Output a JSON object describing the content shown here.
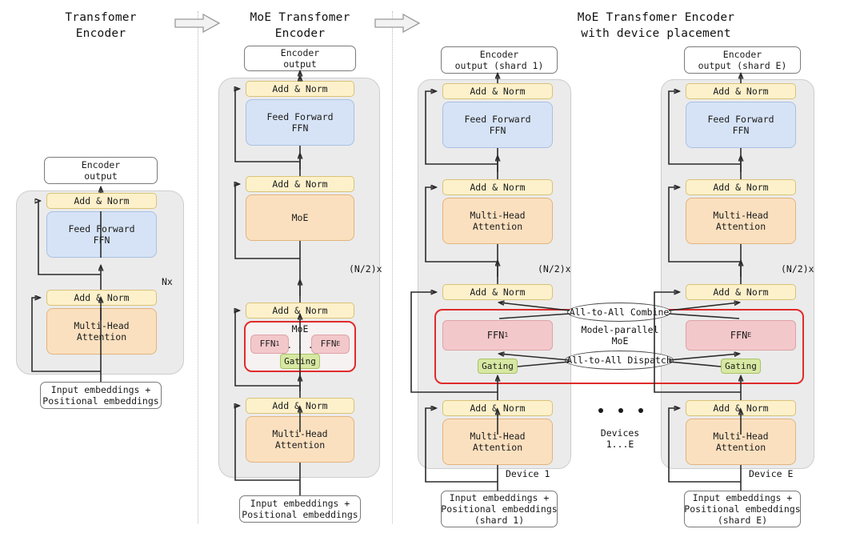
{
  "figure": {
    "type": "architecture-diagram",
    "panels": [
      {
        "id": "transformer-encoder",
        "title": "Transfomer\nEncoder",
        "repeat_label": "Nx",
        "output_box": "Encoder\noutput",
        "input_box": "Input embeddings +\nPositional embeddings",
        "blocks": [
          {
            "label": "Add & Norm",
            "kind": "norm"
          },
          {
            "label": "Feed Forward\nFFN",
            "kind": "ffn"
          },
          {
            "label": "Add & Norm",
            "kind": "norm"
          },
          {
            "label": "Multi-Head\nAttention",
            "kind": "attention"
          }
        ]
      },
      {
        "id": "moe-transformer-encoder",
        "title": "MoE Transfomer\nEncoder",
        "repeat_label": "(N/2)x",
        "output_box": "Encoder\noutput",
        "input_box": "Input embeddings +\nPositional embeddings",
        "blocks": [
          {
            "label": "Add & Norm",
            "kind": "norm"
          },
          {
            "label": "Feed Forward\nFFN",
            "kind": "ffn"
          },
          {
            "label": "Add & Norm",
            "kind": "norm"
          },
          {
            "label": "MoE",
            "kind": "moe"
          },
          {
            "label": "Add & Norm",
            "kind": "norm"
          },
          {
            "label": "Multi-Head\nAttention",
            "kind": "attention"
          }
        ],
        "moe": {
          "title": "MoE",
          "expert_first": "FFN",
          "expert_first_sub": "1",
          "expert_last": "FFN",
          "expert_last_sub": "E",
          "ellipsis": ". . .",
          "gating": "Gating"
        }
      },
      {
        "id": "moe-transformer-encoder-device-placement",
        "title": "MoE Transfomer Encoder\nwith device placement",
        "repeat_label": "(N/2)x",
        "moe_region_label": "Model-parallel\nMoE",
        "devices_label": "Devices\n1...E",
        "dispatch_label": "All-to-All Dispatch",
        "combine_label": "All-to-All Combine",
        "device_columns": [
          {
            "device_name": "Device 1",
            "output_box": "Encoder\noutput (shard 1)",
            "input_box": "Input embeddings +\nPositional embeddings\n(shard 1)",
            "expert": "FFN",
            "expert_sub": "1",
            "gating": "Gating",
            "blocks": [
              {
                "label": "Add & Norm",
                "kind": "norm"
              },
              {
                "label": "Feed Forward\nFFN",
                "kind": "ffn"
              },
              {
                "label": "Add & Norm",
                "kind": "norm"
              },
              {
                "label": "Add & Norm",
                "kind": "norm"
              },
              {
                "label": "Multi-Head\nAttention",
                "kind": "attention"
              }
            ]
          },
          {
            "device_name": "Device E",
            "output_box": "Encoder\noutput (shard E)",
            "input_box": "Input embeddings +\nPositional embeddings\n(shard E)",
            "expert": "FFN",
            "expert_sub": "E",
            "gating": "Gating",
            "blocks": [
              {
                "label": "Add & Norm",
                "kind": "norm"
              },
              {
                "label": "Feed Forward\nFFN",
                "kind": "ffn"
              },
              {
                "label": "Add & Norm",
                "kind": "norm"
              },
              {
                "label": "Add & Norm",
                "kind": "norm"
              },
              {
                "label": "Multi-Head\nAttention",
                "kind": "attention"
              }
            ]
          }
        ]
      }
    ],
    "flow_arrows": [
      "evolution-arrow-1",
      "evolution-arrow-2"
    ],
    "colors": {
      "add_norm": "#fdf1cb",
      "feed_forward": "#d6e3f6",
      "attention": "#fbe0bf",
      "expert": "#f3c8cb",
      "gating": "#d7e8a2",
      "moe_border": "#e02b2b",
      "encoder_background": "#ebebeb",
      "wire": "#2b2b2b"
    }
  }
}
